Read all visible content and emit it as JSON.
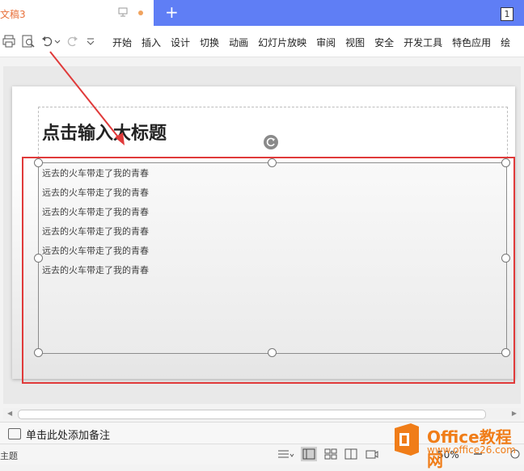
{
  "tab": {
    "doc_title": "文稿3",
    "new_tab": "+",
    "count": "1"
  },
  "toolbar": {
    "menu": [
      "开始",
      "插入",
      "设计",
      "切换",
      "动画",
      "幻灯片放映",
      "审阅",
      "视图",
      "安全",
      "开发工具",
      "特色应用",
      "绘"
    ]
  },
  "slide": {
    "title": "点击输入大标题",
    "lines": [
      "远去的火车带走了我的青春",
      "远去的火车带走了我的青春",
      "远去的火车带走了我的青春",
      "远去的火车带走了我的青春",
      "远去的火车带走了我的青春",
      "远去的火车带走了我的青春"
    ]
  },
  "notes": {
    "text": "单击此处添加备注"
  },
  "status": {
    "theme": "主题",
    "zoom": "50%"
  },
  "watermark": {
    "name": "Office教程网",
    "url": "www.office26.com"
  },
  "colors": {
    "accent": "#5f7ef5",
    "highlight": "#e03a3a",
    "brand": "#f07d18"
  }
}
